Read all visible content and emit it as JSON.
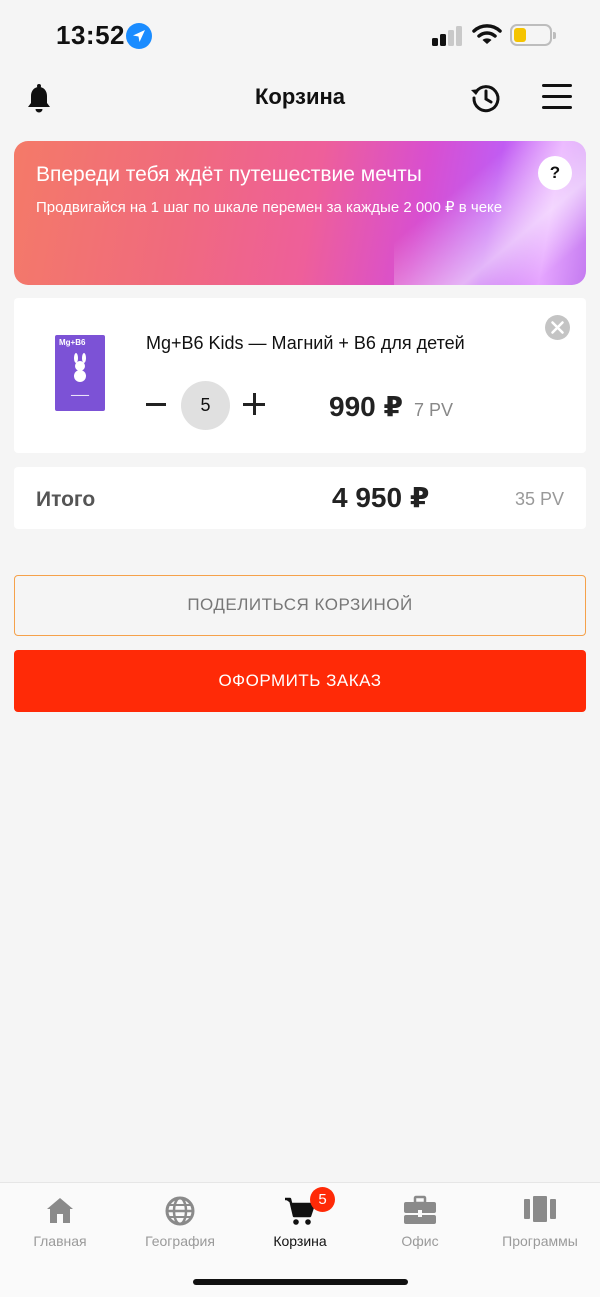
{
  "status_bar": {
    "time": "13:52"
  },
  "header": {
    "title": "Корзина",
    "bell_icon": "bell-icon",
    "history_icon": "history-icon",
    "menu_icon": "menu-icon"
  },
  "promo": {
    "title": "Впереди тебя ждёт путешествие мечты",
    "subtitle": "Продвигайся на 1 шаг по шкале перемен за каждые 2 000 ₽ в чеке",
    "help_label": "?"
  },
  "cart": {
    "items": [
      {
        "name": "Mg+B6 Kids — Магний + B6 для детей",
        "quantity": "5",
        "price": "990 ₽",
        "pv": "7 PV",
        "image_brand": "Mg+B6"
      }
    ]
  },
  "total": {
    "label": "Итого",
    "amount": "4 950 ₽",
    "pv": "35 PV"
  },
  "actions": {
    "share_label": "ПОДЕЛИТЬСЯ КОРЗИНОЙ",
    "order_label": "ОФОРМИТЬ ЗАКАЗ"
  },
  "tab_bar": {
    "tabs": [
      {
        "label": "Главная",
        "icon": "home-icon"
      },
      {
        "label": "География",
        "icon": "globe-icon"
      },
      {
        "label": "Корзина",
        "icon": "cart-icon",
        "active": true
      },
      {
        "label": "Офис",
        "icon": "briefcase-icon"
      },
      {
        "label": "Программы",
        "icon": "programs-icon"
      }
    ],
    "cart_badge": "5"
  },
  "colors": {
    "accent": "#ff2a07",
    "share_border": "#f5a14a",
    "badge": "#ff2a07",
    "location": "#1a8cff"
  }
}
